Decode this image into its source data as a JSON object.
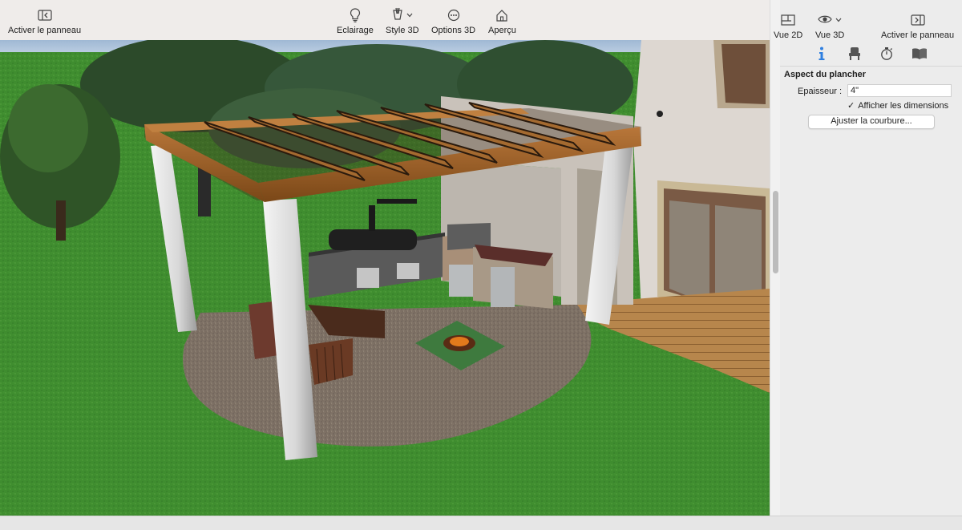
{
  "toolbar": {
    "left": {
      "label": "Activer le panneau",
      "icon": "sidebar-left-icon"
    },
    "center": [
      {
        "label": "Eclairage",
        "icon": "lightbulb-icon"
      },
      {
        "label": "Style 3D",
        "icon": "brush-icon"
      },
      {
        "label": "Options 3D",
        "icon": "ellipsis-circle-icon"
      },
      {
        "label": "Aperçu",
        "icon": "house-icon"
      }
    ]
  },
  "panel": {
    "buttons": [
      {
        "label": "Vue 2D",
        "icon": "floorplan-icon"
      },
      {
        "label": "Vue 3D",
        "icon": "eye-icon"
      },
      {
        "label": "Activer le panneau",
        "icon": "sidebar-right-icon"
      }
    ],
    "tabs": [
      {
        "name": "info",
        "icon": "info-icon",
        "active": true
      },
      {
        "name": "furniture",
        "icon": "chair-icon",
        "active": false
      },
      {
        "name": "timer",
        "icon": "stopwatch-icon",
        "active": false
      },
      {
        "name": "library",
        "icon": "book-icon",
        "active": false
      }
    ],
    "section_title": "Aspect du plancher",
    "thickness_label": "Epaisseur :",
    "thickness_value": "4\"",
    "show_dimensions_label": "Afficher les dimensions",
    "show_dimensions_checked": true,
    "adjust_curve_label": "Ajuster la courbure..."
  },
  "colors": {
    "grass": "#3f8d2f",
    "patio": "#7f7266",
    "wood": "#9a6128",
    "wall": "#ddd7d1",
    "accent": "#2f7fe0"
  }
}
